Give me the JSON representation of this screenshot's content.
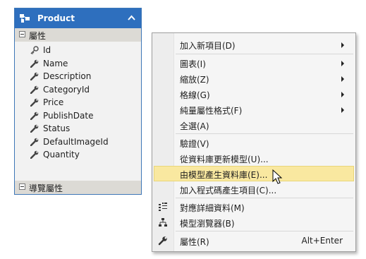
{
  "entity": {
    "title": "Product",
    "properties_header": "屬性",
    "properties": [
      {
        "name": "Id",
        "icon": "key-icon"
      },
      {
        "name": "Name",
        "icon": "wrench-property-icon"
      },
      {
        "name": "Description",
        "icon": "wrench-property-icon"
      },
      {
        "name": "CategoryId",
        "icon": "wrench-property-icon"
      },
      {
        "name": "Price",
        "icon": "wrench-property-icon"
      },
      {
        "name": "PublishDate",
        "icon": "wrench-property-icon"
      },
      {
        "name": "Status",
        "icon": "wrench-property-icon"
      },
      {
        "name": "DefaultImageId",
        "icon": "wrench-property-icon"
      },
      {
        "name": "Quantity",
        "icon": "wrench-property-icon"
      }
    ],
    "navigation_header": "導覽屬性"
  },
  "menu": {
    "items": [
      {
        "label": "加入新項目(D)",
        "submenu": true
      },
      {
        "label": "圖表(I)",
        "submenu": true
      },
      {
        "label": "縮放(Z)",
        "submenu": true
      },
      {
        "label": "格線(G)",
        "submenu": true
      },
      {
        "label": "純量屬性格式(F)",
        "submenu": true
      },
      {
        "label": "全選(A)"
      },
      {
        "label": "驗證(V)"
      },
      {
        "label": "從資料庫更新模型(U)..."
      },
      {
        "label": "由模型產生資料庫(E)...",
        "highlighted": true
      },
      {
        "label": "加入程式碼產生項目(C)..."
      },
      {
        "label": "對應詳細資料(M)",
        "icon": "mapping-details-icon"
      },
      {
        "label": "模型瀏覽器(B)",
        "icon": "model-browser-icon"
      },
      {
        "label": "屬性(R)",
        "icon": "wrench-icon",
        "shortcut": "Alt+Enter"
      }
    ]
  },
  "colors": {
    "entity_header": "#2e6fbe",
    "section_header": "#dcdad5",
    "highlight": "#f9e8a0"
  }
}
